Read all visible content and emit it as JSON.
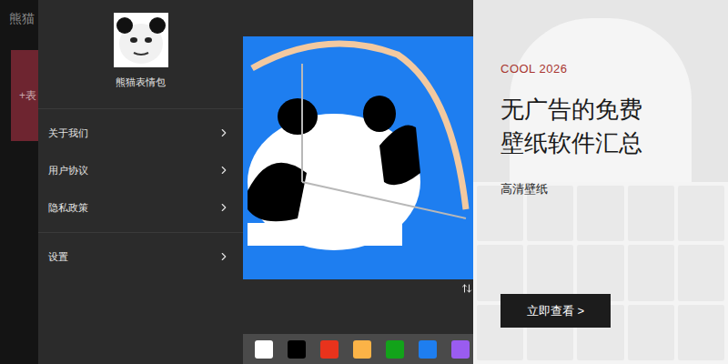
{
  "app": {
    "title": "熊猫",
    "card_label": "+表"
  },
  "drawer": {
    "name": "熊猫表情包",
    "sections": [
      {
        "items": [
          "关于我们",
          "用户协议",
          "隐私政策"
        ]
      },
      {
        "items": [
          "设置"
        ]
      }
    ]
  },
  "palette": [
    {
      "color": "#ffffff"
    },
    {
      "color": "#000000"
    },
    {
      "color": "#e8331c"
    },
    {
      "color": "#fbb347"
    },
    {
      "color": "#12a31a"
    },
    {
      "color": "#1e7ef0"
    },
    {
      "color": "#9a5cf0"
    }
  ],
  "ad": {
    "tag": "COOL 2026",
    "title_lines": [
      "无广告的免费",
      "壁纸软件汇总"
    ],
    "subtitle": "高清壁纸",
    "button": "立即查看 >"
  }
}
